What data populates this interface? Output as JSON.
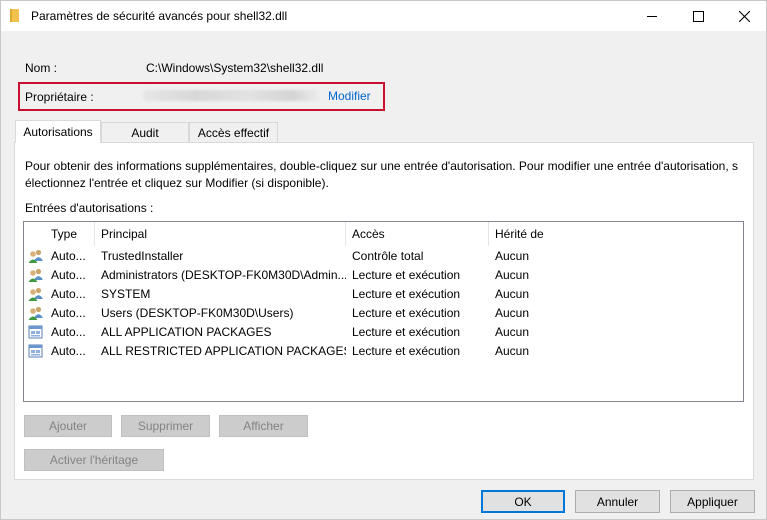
{
  "window": {
    "title": "Paramètres de sécurité avancés pour shell32.dll"
  },
  "fields": {
    "name_label": "Nom :",
    "name_value": "C:\\Windows\\System32\\shell32.dll",
    "owner_label": "Propriétaire :",
    "owner_change_link": "Modifier"
  },
  "tabs": [
    {
      "label": "Autorisations",
      "active": true
    },
    {
      "label": "Audit",
      "active": false
    },
    {
      "label": "Accès effectif",
      "active": false
    }
  ],
  "permissions": {
    "info_line1": "Pour obtenir des informations supplémentaires, double-cliquez sur une entrée d'autorisation. Pour modifier une entrée d'autorisation, s",
    "info_line2": "électionnez l'entrée et cliquez sur Modifier (si disponible).",
    "entries_label": "Entrées d'autorisations :",
    "columns": [
      "Type",
      "Principal",
      "Accès",
      "Hérité de"
    ],
    "rows": [
      {
        "icon": "users-icon",
        "type": "Auto...",
        "principal": "TrustedInstaller",
        "access": "Contrôle total",
        "inherited": "Aucun"
      },
      {
        "icon": "users-icon",
        "type": "Auto...",
        "principal": "Administrators (DESKTOP-FK0M30D\\Admin...",
        "access": "Lecture et exécution",
        "inherited": "Aucun"
      },
      {
        "icon": "users-icon",
        "type": "Auto...",
        "principal": "SYSTEM",
        "access": "Lecture et exécution",
        "inherited": "Aucun"
      },
      {
        "icon": "users-icon",
        "type": "Auto...",
        "principal": "Users (DESKTOP-FK0M30D\\Users)",
        "access": "Lecture et exécution",
        "inherited": "Aucun"
      },
      {
        "icon": "app-package-icon",
        "type": "Auto...",
        "principal": "ALL APPLICATION PACKAGES",
        "access": "Lecture et exécution",
        "inherited": "Aucun"
      },
      {
        "icon": "app-package-icon",
        "type": "Auto...",
        "principal": "ALL RESTRICTED APPLICATION PACKAGES",
        "access": "Lecture et exécution",
        "inherited": "Aucun"
      }
    ],
    "buttons": {
      "add": "Ajouter",
      "remove": "Supprimer",
      "view": "Afficher",
      "enable_inheritance": "Activer l'héritage"
    }
  },
  "footer": {
    "ok": "OK",
    "cancel": "Annuler",
    "apply": "Appliquer"
  },
  "colors": {
    "highlight_border": "#c8102e",
    "link": "#0066cc",
    "default_button_border": "#0078d7"
  }
}
